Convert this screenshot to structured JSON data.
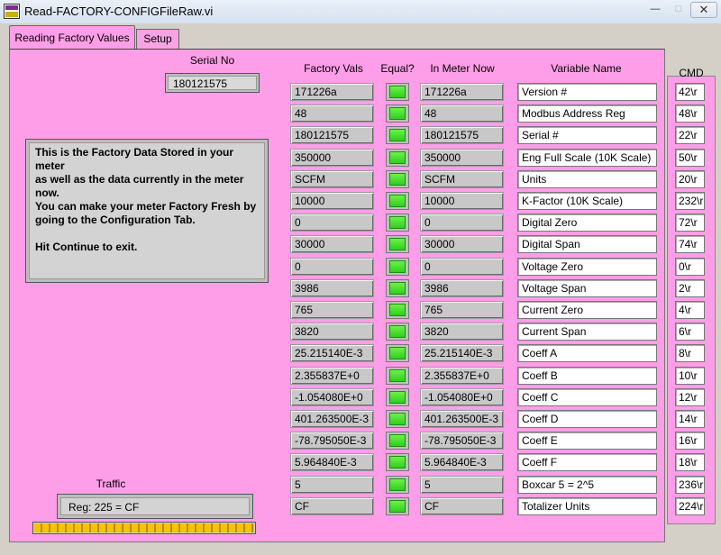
{
  "window": {
    "title": "Read-FACTORY-CONFIGFileRaw.vi",
    "minimize": "—",
    "maximize": "□",
    "close": "✕"
  },
  "tabs": [
    {
      "label": "Reading Factory Values",
      "active": true
    },
    {
      "label": "Setup",
      "active": false
    }
  ],
  "serial": {
    "label": "Serial No",
    "value": "180121575"
  },
  "message": {
    "line1": "This is the Factory Data Stored in your meter",
    "line2": "as well as the data currently in the meter now.",
    "line3": "You can make your meter Factory Fresh by",
    "line4": "going to the Configuration Tab.",
    "line5": "Hit Continue to exit."
  },
  "headers": {
    "factory": "Factory Vals",
    "equal": "Equal?",
    "meter": "In Meter Now",
    "variable": "Variable Name",
    "cmd": "CMD"
  },
  "rows": [
    {
      "factory": "171226a",
      "meter": "171226a",
      "name": "Version #",
      "cmd": "42\\r",
      "equal": true
    },
    {
      "factory": "48",
      "meter": "48",
      "name": "Modbus Address Reg",
      "cmd": "48\\r",
      "equal": true
    },
    {
      "factory": "180121575",
      "meter": "180121575",
      "name": "Serial #",
      "cmd": "22\\r",
      "equal": true
    },
    {
      "factory": "350000",
      "meter": "350000",
      "name": "Eng Full Scale (10K Scale)",
      "cmd": "50\\r",
      "equal": true
    },
    {
      "factory": "SCFM",
      "meter": "SCFM",
      "name": "Units",
      "cmd": "20\\r",
      "equal": true
    },
    {
      "factory": "10000",
      "meter": "10000",
      "name": "K-Factor (10K Scale)",
      "cmd": "232\\r",
      "equal": true
    },
    {
      "factory": "0",
      "meter": "0",
      "name": "Digital Zero",
      "cmd": "72\\r",
      "equal": true
    },
    {
      "factory": "30000",
      "meter": "30000",
      "name": "Digital Span",
      "cmd": "74\\r",
      "equal": true
    },
    {
      "factory": "0",
      "meter": "0",
      "name": "Voltage Zero",
      "cmd": "0\\r",
      "equal": true
    },
    {
      "factory": "3986",
      "meter": "3986",
      "name": "Voltage Span",
      "cmd": "2\\r",
      "equal": true
    },
    {
      "factory": "765",
      "meter": "765",
      "name": "Current Zero",
      "cmd": "4\\r",
      "equal": true
    },
    {
      "factory": "3820",
      "meter": "3820",
      "name": "Current Span",
      "cmd": "6\\r",
      "equal": true
    },
    {
      "factory": "25.215140E-3",
      "meter": "25.215140E-3",
      "name": "Coeff A",
      "cmd": "8\\r",
      "equal": true
    },
    {
      "factory": "2.355837E+0",
      "meter": "2.355837E+0",
      "name": "Coeff B",
      "cmd": "10\\r",
      "equal": true
    },
    {
      "factory": "-1.054080E+0",
      "meter": "-1.054080E+0",
      "name": "Coeff C",
      "cmd": "12\\r",
      "equal": true
    },
    {
      "factory": "401.263500E-3",
      "meter": "401.263500E-3",
      "name": "Coeff D",
      "cmd": "14\\r",
      "equal": true
    },
    {
      "factory": "-78.795050E-3",
      "meter": "-78.795050E-3",
      "name": "Coeff E",
      "cmd": "16\\r",
      "equal": true
    },
    {
      "factory": "5.964840E-3",
      "meter": "5.964840E-3",
      "name": "Coeff F",
      "cmd": "18\\r",
      "equal": true
    },
    {
      "factory": "5",
      "meter": "5",
      "name": "Boxcar 5 = 2^5",
      "cmd": "236\\r",
      "equal": true
    },
    {
      "factory": "CF",
      "meter": "CF",
      "name": "Totalizer Units",
      "cmd": "224\\r",
      "equal": true
    }
  ],
  "traffic": {
    "label": "Traffic",
    "value": "Reg: 225 = CF",
    "progress": 1.0
  },
  "colors": {
    "panel": "#ff9ee8",
    "led_on": "#3fdc2a",
    "progress": "#f5c400"
  }
}
